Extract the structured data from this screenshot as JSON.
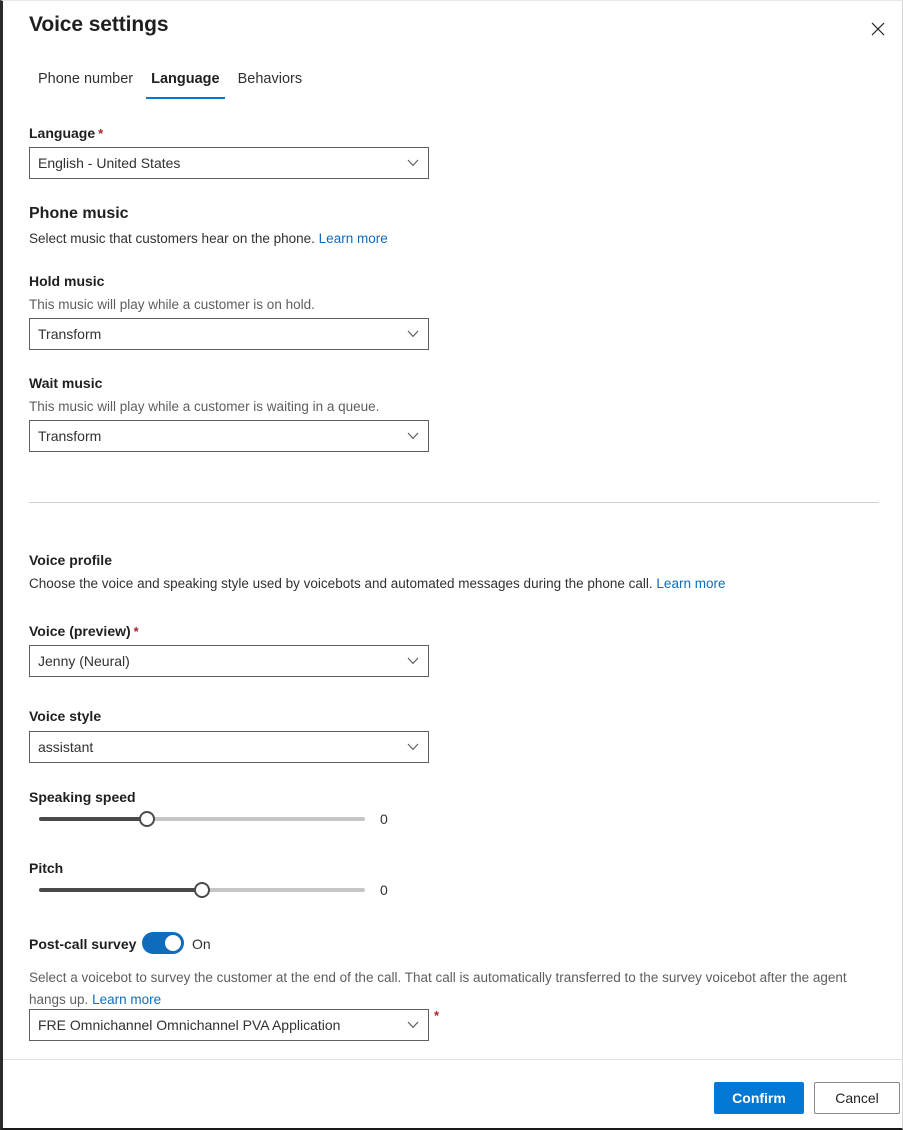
{
  "window": {
    "title": "Voice settings",
    "close_icon": "close-icon"
  },
  "tabs": [
    {
      "label": "Phone number",
      "active": false
    },
    {
      "label": "Language",
      "active": true
    },
    {
      "label": "Behaviors",
      "active": false
    }
  ],
  "language_field": {
    "label": "Language",
    "required_marker": "*",
    "value": "English - United States",
    "chevron_icon": "chevron-down-icon"
  },
  "phone_music": {
    "heading": "Phone music",
    "description": "Select music that customers hear on the phone.",
    "learn_more": "Learn more",
    "hold": {
      "label": "Hold music",
      "helper": "This music will play while a customer is on hold.",
      "value": "Transform"
    },
    "wait": {
      "label": "Wait music",
      "helper": "This music will play while a customer is waiting in a queue.",
      "value": "Transform"
    }
  },
  "voice_profile": {
    "heading": "Voice profile",
    "description": "Choose the voice and speaking style used by voicebots and automated messages during the phone call.",
    "learn_more": "Learn more",
    "voice": {
      "label": "Voice (preview)",
      "required_marker": "*",
      "value": "Jenny (Neural)"
    },
    "voice_style": {
      "label": "Voice style",
      "value": "assistant"
    },
    "speaking_speed": {
      "label": "Speaking speed",
      "value": "0",
      "percent": 33
    },
    "pitch": {
      "label": "Pitch",
      "value": "0",
      "percent": 50
    }
  },
  "post_call_survey": {
    "label": "Post-call survey",
    "toggle_state": "On",
    "toggle_on": true,
    "description": "Select a voicebot to survey the customer at the end of the call. That call is automatically transferred to the survey voicebot after the agent hangs up.",
    "learn_more": "Learn more",
    "voicebot_value": "FRE Omnichannel Omnichannel PVA Application",
    "required_marker": "*"
  },
  "footer": {
    "confirm_label": "Confirm",
    "cancel_label": "Cancel"
  },
  "colors": {
    "accent": "#0078d4",
    "link": "#0f6cbd",
    "required": "#a4262c",
    "toggle_on": "#0f6cbd"
  }
}
